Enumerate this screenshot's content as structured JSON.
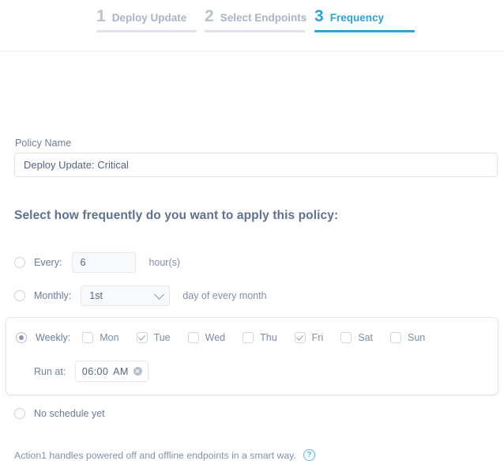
{
  "stepper": {
    "steps": [
      {
        "number": "1",
        "label": "Deploy Update",
        "state": "inactive"
      },
      {
        "number": "2",
        "label": "Select Endpoints",
        "state": "inactive"
      },
      {
        "number": "3",
        "label": "Frequency",
        "state": "active"
      }
    ],
    "active_color": "#29a3dc",
    "inactive_color": "#aab4c4"
  },
  "form": {
    "policy_name_label": "Policy Name",
    "policy_name_value": "Deploy Update: Critical",
    "policy_name_placeholder": "Policy Name",
    "section_title": "Select how frequently do you want to apply this policy:"
  },
  "frequency": {
    "every": {
      "label": "Every:",
      "selected": false,
      "value": "6",
      "placeholder": "6",
      "suffix": "hour(s)"
    },
    "monthly": {
      "label": "Monthly:",
      "selected": false,
      "day_value": "1st",
      "suffix": "day of every month"
    },
    "weekly": {
      "label": "Weekly:",
      "selected": true,
      "days": [
        {
          "label": "Mon",
          "checked": false
        },
        {
          "label": "Tue",
          "checked": true
        },
        {
          "label": "Wed",
          "checked": false
        },
        {
          "label": "Thu",
          "checked": false
        },
        {
          "label": "Fri",
          "checked": true
        },
        {
          "label": "Sat",
          "checked": false
        },
        {
          "label": "Sun",
          "checked": false
        }
      ],
      "run_at_label": "Run at:",
      "run_at_time": "06:00",
      "run_at_meridiem": "AM",
      "clear_icon": "clear-circle-icon"
    },
    "no_schedule": {
      "label": "No schedule yet",
      "selected": false
    }
  },
  "footer": {
    "note": "Action1 handles powered off and offline endpoints in a smart way.",
    "help_icon": "help-question-icon",
    "help_glyph": "?",
    "help_color": "#5bb8e8"
  }
}
